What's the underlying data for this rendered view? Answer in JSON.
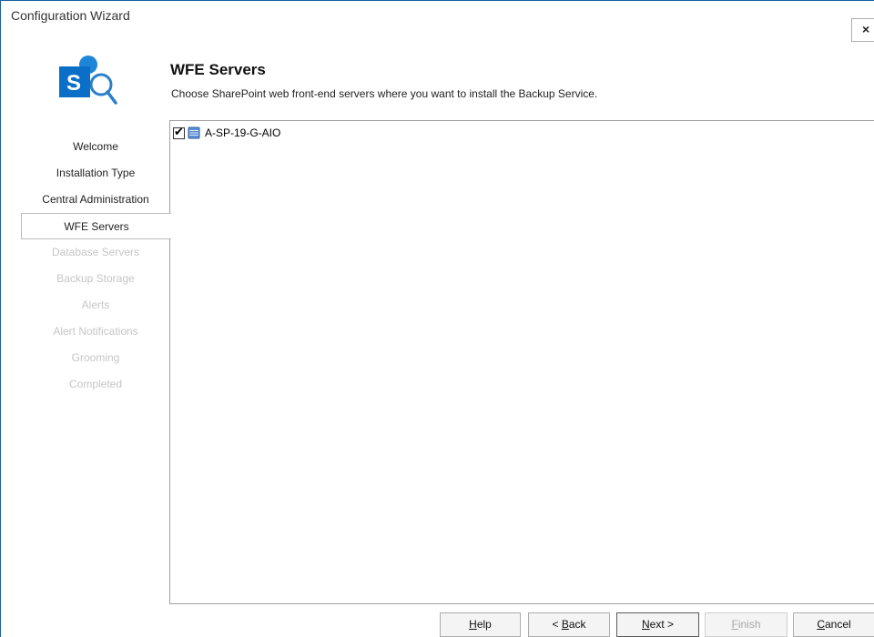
{
  "window": {
    "title": "Configuration Wizard",
    "close_glyph": "×"
  },
  "logo": {
    "letter": "S",
    "icon": "sharepoint-logo-icon"
  },
  "nav": {
    "items": [
      {
        "label": "Welcome",
        "state": "done"
      },
      {
        "label": "Installation Type",
        "state": "done"
      },
      {
        "label": "Central Administration",
        "state": "done"
      },
      {
        "label": "WFE Servers",
        "state": "active"
      },
      {
        "label": "Database Servers",
        "state": "disabled"
      },
      {
        "label": "Backup Storage",
        "state": "disabled"
      },
      {
        "label": "Alerts",
        "state": "disabled"
      },
      {
        "label": "Alert Notifications",
        "state": "disabled"
      },
      {
        "label": "Grooming",
        "state": "disabled"
      },
      {
        "label": "Completed",
        "state": "disabled"
      }
    ]
  },
  "page": {
    "title": "WFE Servers",
    "description": "Choose SharePoint web front-end servers where you want to install the Backup Service."
  },
  "servers": [
    {
      "name": "A-SP-19-G-AIO",
      "checked": true,
      "icon": "server-icon"
    }
  ],
  "buttons": {
    "help": {
      "mnemonic": "H",
      "rest": "elp"
    },
    "back": {
      "prefix": "< ",
      "mnemonic": "B",
      "rest": "ack"
    },
    "next": {
      "mnemonic": "N",
      "rest": "ext >"
    },
    "finish": {
      "mnemonic": "F",
      "rest": "inish"
    },
    "cancel": {
      "mnemonic": "C",
      "rest": "ancel"
    }
  },
  "colors": {
    "accent": "#0b6fc7",
    "border": "#1b5fa8",
    "disabled_text": "#c6c6c6"
  }
}
